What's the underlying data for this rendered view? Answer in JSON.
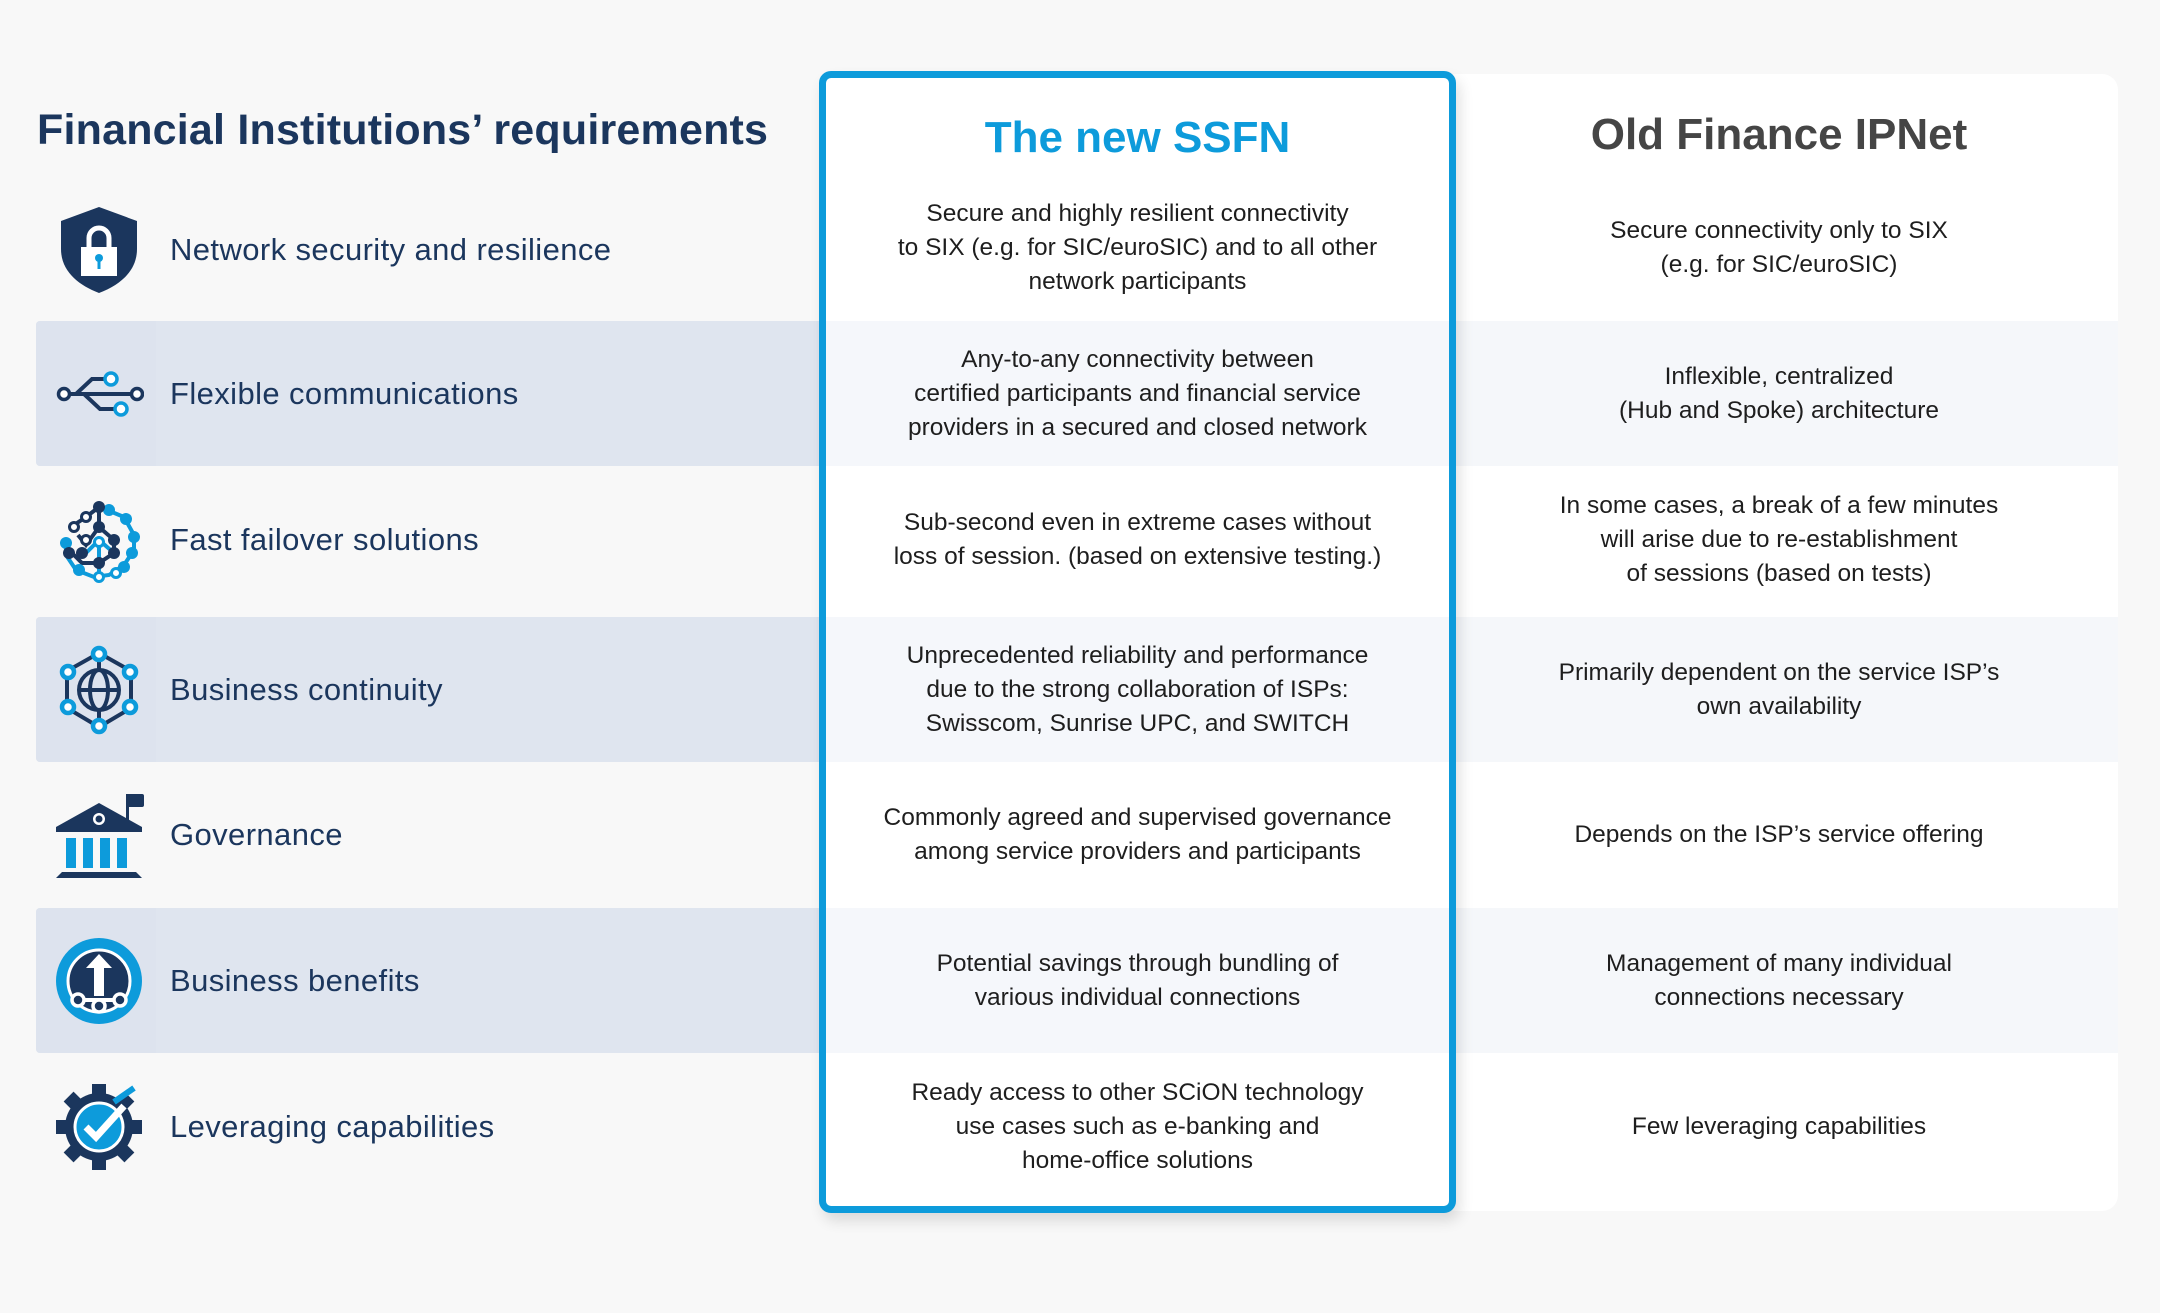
{
  "header": {
    "requirements_title": "Financial Institutions’ requirements",
    "ssfn_title": "The new SSFN",
    "old_title": "Old Finance IPNet"
  },
  "colors": {
    "navy": "#1b365d",
    "accent_blue": "#0d9bdb",
    "old_title_gray": "#454545",
    "band_left": "#dfe5ef",
    "band_columns": "#f5f7fa",
    "page_background": "#f8f8f8"
  },
  "rows": [
    {
      "icon": "shield-lock-icon",
      "requirement": "Network security and resilience",
      "ssfn": "Secure and highly resilient connectivity\nto SIX (e.g. for SIC/euroSIC) and to all other\nnetwork participants",
      "old": "Secure connectivity only to SIX\n(e.g. for SIC/euroSIC)"
    },
    {
      "icon": "usb-connection-icon",
      "requirement": "Flexible communications",
      "ssfn": "Any-to-any connectivity between\ncertified participants and financial service\nproviders in a secured and closed network",
      "old": "Inflexible, centralized\n(Hub and Spoke) architecture"
    },
    {
      "icon": "network-nodes-icon",
      "requirement": "Fast failover solutions",
      "ssfn": "Sub-second even in extreme cases without\nloss of session. (based on extensive testing.)",
      "old": "In some cases, a break of a few minutes\nwill arise due to re-establishment\nof sessions (based on tests)"
    },
    {
      "icon": "globe-network-icon",
      "requirement": "Business continuity",
      "ssfn": "Unprecedented reliability and performance\ndue to the strong collaboration of ISPs:\nSwisscom, Sunrise UPC, and SWITCH",
      "old": "Primarily dependent on the service ISP’s\nown availability"
    },
    {
      "icon": "government-building-icon",
      "requirement": "Governance",
      "ssfn": "Commonly agreed and supervised governance\namong service providers and participants",
      "old": "Depends on the ISP’s service offering"
    },
    {
      "icon": "growth-arrow-circle-icon",
      "requirement": "Business benefits",
      "ssfn": "Potential savings through bundling of\nvarious individual connections",
      "old": "Management of many individual\nconnections necessary"
    },
    {
      "icon": "gear-check-icon",
      "requirement": "Leveraging capabilities",
      "ssfn": "Ready access to other SCiON technology\nuse cases such as e-banking and\nhome-office solutions",
      "old": "Few leveraging capabilities"
    }
  ]
}
